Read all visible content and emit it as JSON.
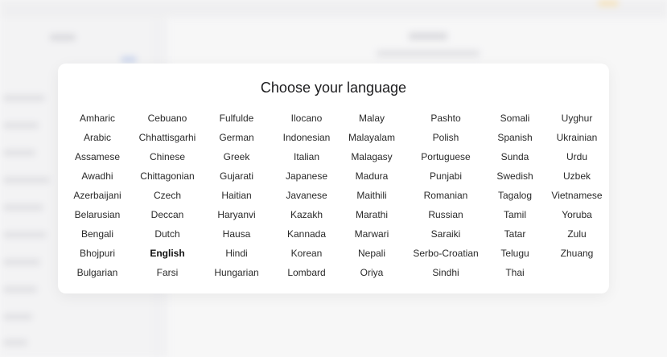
{
  "modal": {
    "title": "Choose your language",
    "selected": "English",
    "columns": [
      [
        "Amharic",
        "Arabic",
        "Assamese",
        "Awadhi",
        "Azerbaijani",
        "Belarusian",
        "Bengali",
        "Bhojpuri",
        "Bulgarian"
      ],
      [
        "Cebuano",
        "Chhattisgarhi",
        "Chinese",
        "Chittagonian",
        "Czech",
        "Deccan",
        "Dutch",
        "English",
        "Farsi"
      ],
      [
        "Fulfulde",
        "German",
        "Greek",
        "Gujarati",
        "Haitian",
        "Haryanvi",
        "Hausa",
        "Hindi",
        "Hungarian"
      ],
      [
        "Ilocano",
        "Indonesian",
        "Italian",
        "Japanese",
        "Javanese",
        "Kazakh",
        "Kannada",
        "Korean",
        "Lombard"
      ],
      [
        "Malay",
        "Malayalam",
        "Malagasy",
        "Madura",
        "Maithili",
        "Marathi",
        "Marwari",
        "Nepali",
        "Oriya"
      ],
      [
        "Pashto",
        "Polish",
        "Portuguese",
        "Punjabi",
        "Romanian",
        "Russian",
        "Saraiki",
        "Serbo-Croatian",
        "Sindhi"
      ],
      [
        "Somali",
        "Spanish",
        "Sunda",
        "Swedish",
        "Tagalog",
        "Tamil",
        "Tatar",
        "Telugu",
        "Thai"
      ],
      [
        "Uyghur",
        "Ukrainian",
        "Urdu",
        "Uzbek",
        "Vietnamese",
        "Yoruba",
        "Zulu",
        "Zhuang"
      ]
    ]
  },
  "colors": {
    "modal_bg": "#ffffff",
    "text": "#2a2a2a",
    "page_bg": "#f7f7f8"
  }
}
